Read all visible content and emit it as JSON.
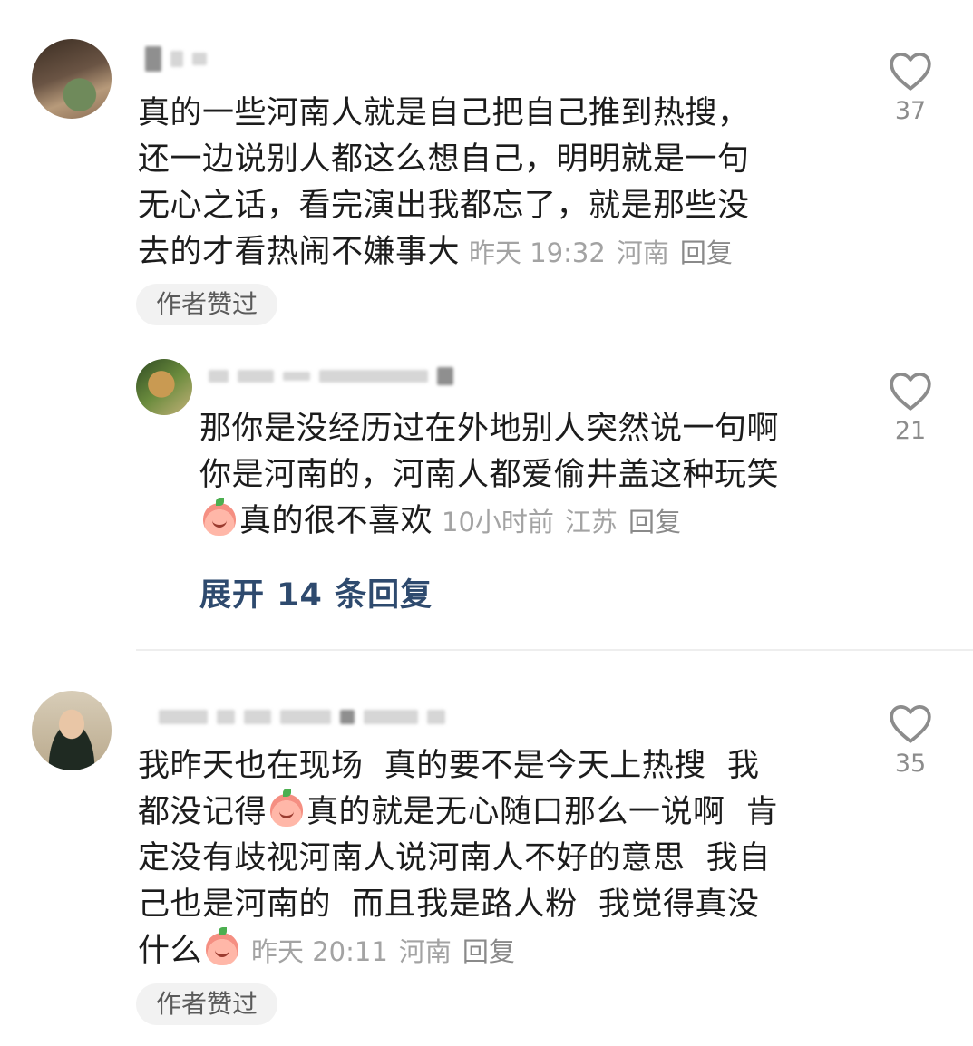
{
  "comments": [
    {
      "text": "真的一些河南人就是自己把自己推到热搜，还一边说别人都这么想自己，明明就是一句无心之话，看完演出我都忘了，就是那些没去的才看热闹不嫌事大",
      "lines": [
        "真的一些河南人就是自己把自己推到热搜，",
        "还一边说别人都这么想自己，明明就是一句",
        "无心之话，看完演出我都忘了，就是那些没",
        "去的才看热闹不嫌事大"
      ],
      "time": "昨天 19:32",
      "location": "河南",
      "reply_label": "回复",
      "badge": "作者赞过",
      "likes": "37"
    },
    {
      "lines": [
        "那你是没经历过在外地别人突然说一句啊",
        "你是河南的，河南人都爱偷井盖这种玩笑",
        "真的很不喜欢"
      ],
      "time": "10小时前",
      "location": "江苏",
      "reply_label": "回复",
      "likes": "21"
    },
    {
      "lines": [
        "我昨天也在现场  真的要不是今天上热搜  我",
        "都没记得",
        "真的就是无心随口那么一说啊  肯",
        "定没有歧视河南人说河南人不好的意思  我自",
        "己也是河南的  而且我是路人粉  我觉得真没",
        "什么"
      ],
      "time": "昨天 20:11",
      "location": "河南",
      "reply_label": "回复",
      "badge": "作者赞过",
      "likes": "35"
    }
  ],
  "expand_replies": "展开 14 条回复",
  "icons": {
    "like": "heart-outline-icon",
    "emoji": "crying-peach-emoji"
  },
  "colors": {
    "link": "#2e4a6e",
    "meta": "#a3a3a3",
    "badge_bg": "#f2f2f2"
  }
}
